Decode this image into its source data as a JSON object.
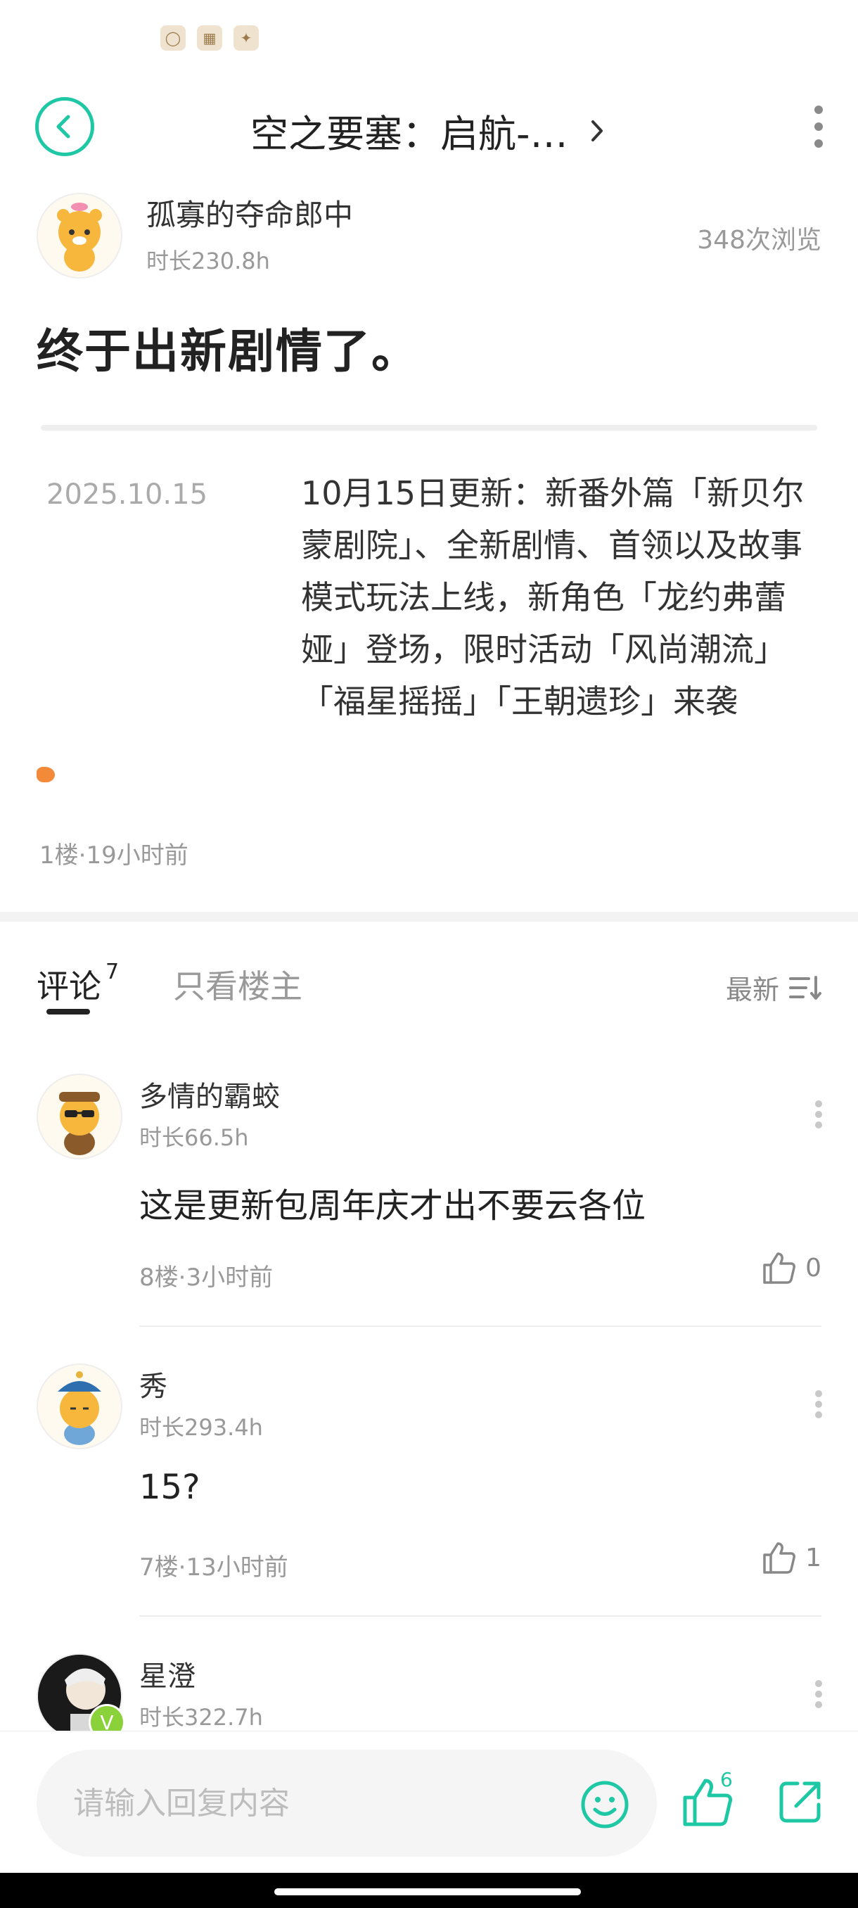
{
  "header": {
    "title": "空之要塞：启航-…"
  },
  "author": {
    "name": "孤寡的夺命郎中",
    "play_time": "时长230.8h",
    "views": "348次浏览"
  },
  "post": {
    "title": "终于出新剧情了。",
    "update_date": "2025.10.15",
    "update_text": "10月15日更新：新番外篇「新贝尔蒙剧院」、全新剧情、首领以及故事模式玩法上线，新角色「龙约弗蕾娅」登场，限时活动「风尚潮流」「福星摇摇」「王朝遗珍」来袭",
    "floor_meta": "1楼·19小时前"
  },
  "tabs": {
    "comments_label": "评论",
    "comments_count": "7",
    "owner_only_label": "只看楼主",
    "sort_label": "最新"
  },
  "comments": [
    {
      "name": "多情的霸蛟",
      "play_time": "时长66.5h",
      "body": "这是更新包周年庆才出不要云各位",
      "floor": "8楼·3小时前",
      "likes": "0"
    },
    {
      "name": "秀",
      "play_time": "时长293.4h",
      "body": "15?",
      "floor": "7楼·13小时前",
      "likes": "1"
    },
    {
      "name": "星澄",
      "play_time": "时长322.7h"
    }
  ],
  "reply": {
    "placeholder": "请输入回复内容",
    "like_count": "6"
  },
  "colors": {
    "accent": "#1ec8a5",
    "text_primary": "#222222",
    "text_secondary": "#999999"
  }
}
